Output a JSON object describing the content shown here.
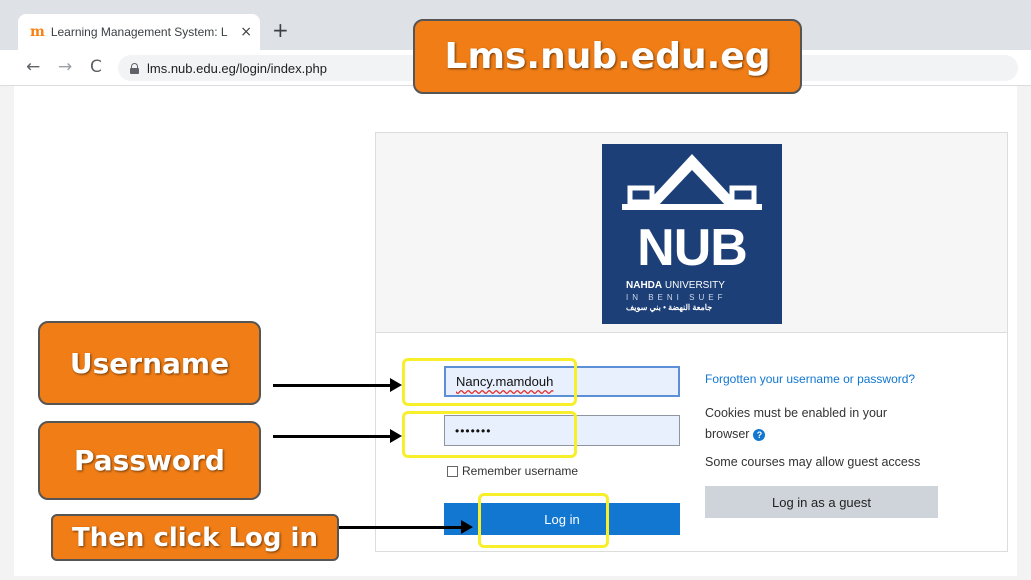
{
  "browser": {
    "tab_title": "Learning Management System: L",
    "tab_favicon": "m",
    "tab_close": "×",
    "new_tab": "+",
    "nav_back": "←",
    "nav_forward": "→",
    "nav_reload": "C",
    "url": "lms.nub.edu.eg/login/index.php"
  },
  "logo": {
    "acronym": "NUB",
    "name_bold": "NAHDA",
    "name_thin": " UNIVERSITY",
    "location": "IN BENI SUEF",
    "arabic": "جامعة النهضة • بني سويف"
  },
  "login": {
    "username_value": "Nancy.mamdouh",
    "password_value": "•••••••",
    "remember_label": "Remember username",
    "login_button": "Log in",
    "forgot_link": "Forgotten your username or password?",
    "cookies_text": "Cookies must be enabled in your browser",
    "help_icon": "?",
    "guest_text": "Some courses may allow guest access",
    "guest_button": "Log in as a guest"
  },
  "annotations": {
    "title": "Lms.nub.edu.eg",
    "username": "Username",
    "password": "Password",
    "login": "Then click Log in",
    "callout_color": "#f07d16",
    "highlight_color": "#f7ef2a"
  }
}
